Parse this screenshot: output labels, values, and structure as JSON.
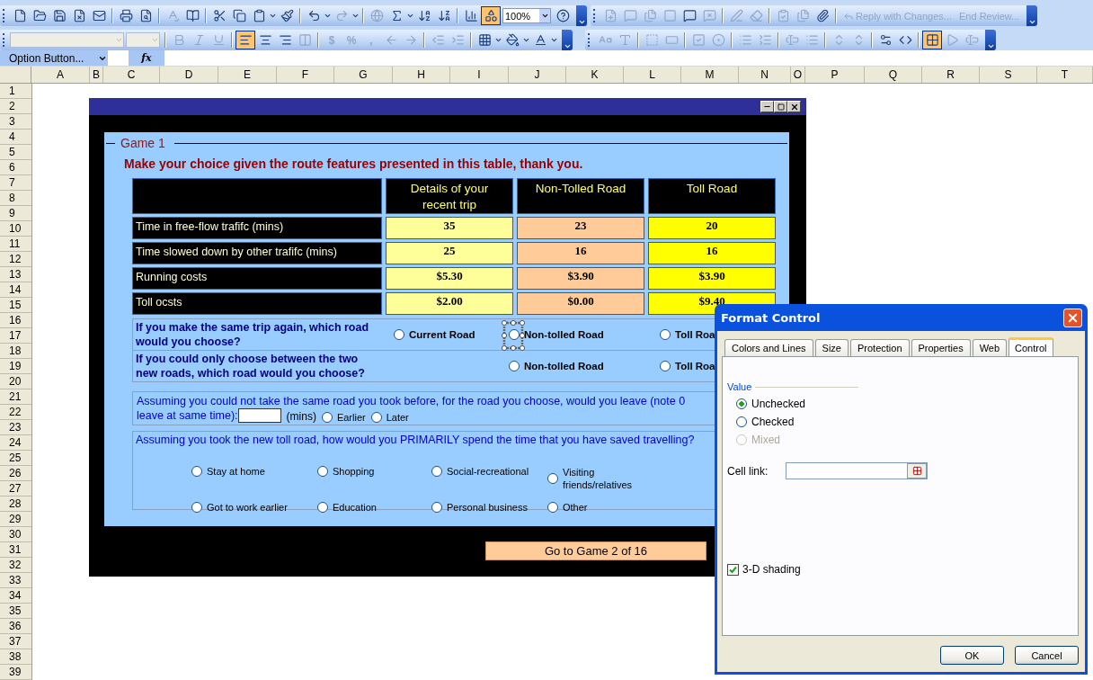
{
  "toolbar": {
    "zoom": "100%",
    "review": [
      "Reply with Changes...",
      "End Review..."
    ],
    "format_symbols": [
      "$",
      "%",
      ","
    ]
  },
  "formula_bar": {
    "name_box": "Option Button...",
    "function_label": "fx"
  },
  "columns": [
    "A",
    "B",
    "C",
    "D",
    "E",
    "F",
    "G",
    "H",
    "I",
    "J",
    "K",
    "L",
    "M",
    "N",
    "O",
    "P",
    "Q",
    "R",
    "S",
    "T"
  ],
  "rows": [
    "1",
    "2",
    "3",
    "4",
    "5",
    "6",
    "7",
    "8",
    "9",
    "10",
    "11",
    "12",
    "13",
    "14",
    "15",
    "16",
    "17",
    "18",
    "19",
    "20",
    "21",
    "22",
    "23",
    "24",
    "25",
    "26",
    "27",
    "28",
    "29",
    "30",
    "31",
    "32",
    "33",
    "34",
    "35",
    "36",
    "37",
    "38",
    "39"
  ],
  "userform": {
    "frame_title": "Game 1",
    "instruction": "Make your choice given the route features presented in this table, thank you.",
    "table": {
      "columns": [
        {
          "label": "Details of your recent trip",
          "color": "#ffff99"
        },
        {
          "label": "Non-Tolled Road",
          "color": "#ffcc99"
        },
        {
          "label": "Toll Road",
          "color": "#ffff00"
        }
      ],
      "rows": [
        {
          "label": "Time in free-flow trafifc (mins)",
          "values": [
            "35",
            "23",
            "20"
          ]
        },
        {
          "label": "Time slowed down by other trafifc (mins)",
          "values": [
            "25",
            "16",
            "16"
          ]
        },
        {
          "label": "Running costs",
          "values": [
            "$5.30",
            "$3.90",
            "$3.90"
          ]
        },
        {
          "label": "Toll ocsts",
          "values": [
            "$2.00",
            "$0.00",
            "$9.40"
          ]
        }
      ]
    },
    "choice_questions": [
      {
        "text": "If you make the same trip again, which road would you choose?",
        "options": [
          {
            "label": "Current Road",
            "selected": false,
            "design_selected": false
          },
          {
            "label": "Non-tolled Road",
            "selected": false,
            "design_selected": true
          },
          {
            "label": "Toll Roa",
            "selected": false,
            "design_selected": false
          }
        ]
      },
      {
        "text": "If you could only choose between the two new roads, which road would you choose?",
        "options": [
          {
            "label": "Non-tolled Road",
            "selected": false,
            "design_selected": false
          },
          {
            "label": "Toll Roa",
            "selected": false,
            "design_selected": false
          }
        ]
      }
    ],
    "departure_question": {
      "lines": [
        "Assuming you could not take the same road you took before, for the road you choose, would you leave (note 0",
        "leave at same time):"
      ],
      "unit": "(mins)",
      "options": [
        {
          "label": "Earlier",
          "selected": false
        },
        {
          "label": "Later",
          "selected": false
        }
      ]
    },
    "time_use_question": {
      "text": "Assuming you took the new toll road, how would you PRIMARILY spend the time that you have saved travelling?",
      "options": [
        {
          "label": "Stay at home",
          "selected": false
        },
        {
          "label": "Shopping",
          "selected": false
        },
        {
          "label": "Social-recreational",
          "selected": false
        },
        {
          "label": "Visiting friends/relatives",
          "selected": false
        },
        {
          "label": "Got to work earlier",
          "selected": false
        },
        {
          "label": "Education",
          "selected": false
        },
        {
          "label": "Personal business",
          "selected": false
        },
        {
          "label": "Other",
          "selected": false
        }
      ]
    },
    "next_button": "Go to Game 2 of 16"
  },
  "dialog": {
    "title": "Format Control",
    "tabs": [
      {
        "label": "Colors and Lines",
        "selected": false
      },
      {
        "label": "Size",
        "selected": false
      },
      {
        "label": "Protection",
        "selected": false
      },
      {
        "label": "Properties",
        "selected": false
      },
      {
        "label": "Web",
        "selected": false
      },
      {
        "label": "Control",
        "selected": true
      }
    ],
    "value_group": "Value",
    "value_options": [
      {
        "label": "Unchecked",
        "selected": true,
        "disabled": false
      },
      {
        "label": "Checked",
        "selected": false,
        "disabled": false
      },
      {
        "label": "Mixed",
        "selected": false,
        "disabled": true
      }
    ],
    "cell_link_label": "Cell link:",
    "shading": {
      "label": "3-D shading",
      "checked": true
    },
    "buttons": [
      "OK",
      "Cancel"
    ]
  }
}
